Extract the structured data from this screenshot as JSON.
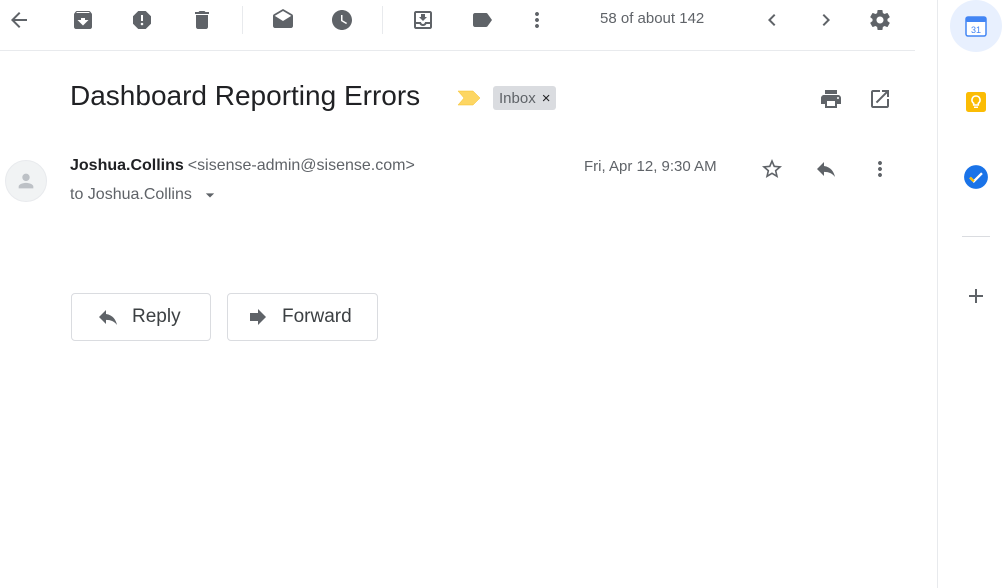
{
  "toolbar": {
    "counter": "58 of about 142",
    "icons": [
      "back-arrow-icon",
      "archive-icon",
      "report-spam-icon",
      "delete-icon",
      "mark-unread-icon",
      "snooze-icon",
      "move-to-icon",
      "labels-icon",
      "more-vert-icon",
      "prev-chevron-icon",
      "next-chevron-icon",
      "settings-icon"
    ]
  },
  "subject": {
    "title": "Dashboard Reporting Errors",
    "label": "Inbox",
    "remove_label": "×",
    "importance_color": "#fdd663"
  },
  "message": {
    "sender_name": "Joshua.Collins",
    "sender_email": "<sisense-admin@sisense.com>",
    "to_line": "to Joshua.Collins",
    "date": "Fri, Apr 12, 9:30 AM"
  },
  "actions": {
    "reply_label": "Reply",
    "forward_label": "Forward"
  },
  "side_panel": {
    "calendar_day": "31",
    "apps": [
      "calendar-icon",
      "keep-icon",
      "tasks-icon",
      "add-icon"
    ],
    "colors": {
      "calendar": "#4285f4",
      "keep": "#fbbc04",
      "tasks": "#1a73e8"
    }
  }
}
